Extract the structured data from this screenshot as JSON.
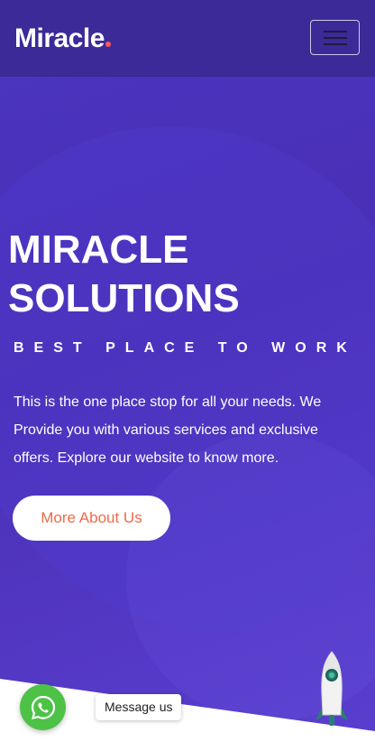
{
  "header": {
    "brand": "Miracle",
    "brand_dot_color": "#ff5a5a",
    "menu_icon": "hamburger-menu-icon"
  },
  "hero": {
    "title": "MIRACLE SOLUTIONS",
    "subtitle": "BEST PLACE TO WORK",
    "description": "This is the one place stop for all your needs. We Provide you with various services and exclusive offers. Explore our website to know more.",
    "button_label": "More About Us"
  },
  "floating": {
    "whatsapp_label": "Message us",
    "whatsapp_icon": "whatsapp-icon",
    "scroll_top_icon": "rocket-icon"
  },
  "colors": {
    "header_bg": "#3c2a98",
    "hero_bg": "#4a2fb5",
    "button_text": "#ef6a47",
    "whatsapp_green": "#4dc247"
  }
}
